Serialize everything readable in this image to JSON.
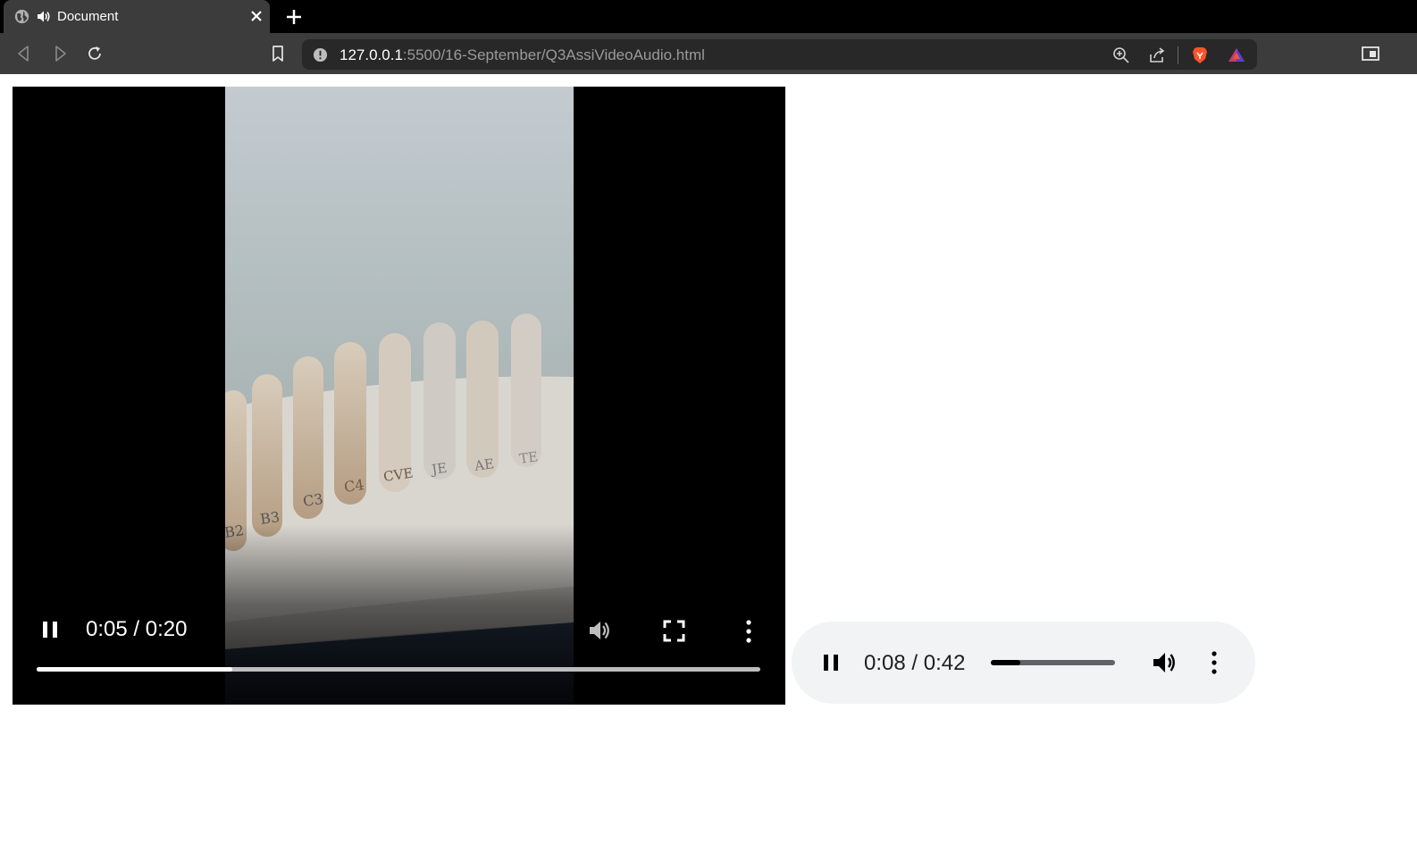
{
  "browser": {
    "tab": {
      "title": "Document"
    },
    "url": {
      "host": "127.0.0.1",
      "path": ":5500/16-September/Q3AssiVideoAudio.html"
    }
  },
  "video": {
    "time_display": "0:05 / 0:20",
    "current_seconds": 5,
    "duration_seconds": 20,
    "progress_fraction": 0.27,
    "swatch_labels": [
      "B2",
      "B3",
      "C3",
      "C4",
      "CVE",
      "JE",
      "AE",
      "TE"
    ]
  },
  "audio": {
    "time_display": "0:08 / 0:42",
    "current_seconds": 8,
    "duration_seconds": 42,
    "progress_fraction": 0.24
  },
  "colors": {
    "tab_strip": "#000000",
    "toolbar": "#3c3c3c",
    "omnibox": "#282828",
    "audio_bg": "#f1f3f4",
    "brave_orange": "#fb542b"
  }
}
